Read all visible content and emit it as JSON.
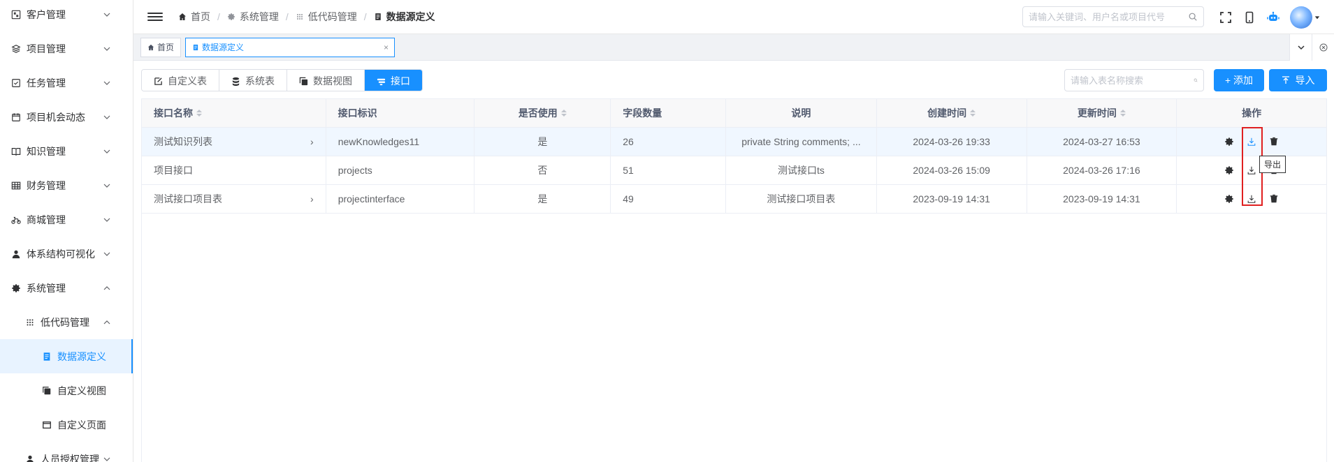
{
  "sidebar": {
    "items": [
      {
        "label": "客户管理",
        "icon": "customer-icon",
        "expanded": false
      },
      {
        "label": "项目管理",
        "icon": "layers-icon",
        "expanded": false
      },
      {
        "label": "任务管理",
        "icon": "task-icon",
        "expanded": false
      },
      {
        "label": "项目机会动态",
        "icon": "calendar-icon",
        "expanded": false
      },
      {
        "label": "知识管理",
        "icon": "book-icon",
        "expanded": false
      },
      {
        "label": "财务管理",
        "icon": "grid-icon",
        "expanded": false
      },
      {
        "label": "商城管理",
        "icon": "bike-icon",
        "expanded": false
      },
      {
        "label": "体系结构可视化",
        "icon": "user-icon",
        "expanded": false
      },
      {
        "label": "系统管理",
        "icon": "gear-icon",
        "expanded": true
      }
    ],
    "sub_group": {
      "label": "低代码管理",
      "icon": "dots-grid-icon"
    },
    "sub_items": [
      {
        "label": "数据源定义",
        "icon": "doc-icon",
        "active": true
      },
      {
        "label": "自定义视图",
        "icon": "copy-icon"
      },
      {
        "label": "自定义页面",
        "icon": "window-icon"
      }
    ],
    "cut_item": {
      "label": "人员授权管理",
      "icon": "user-icon"
    }
  },
  "header": {
    "breadcrumb": [
      {
        "label": "首页",
        "icon": "home-icon"
      },
      {
        "label": "系统管理",
        "icon": "gear-icon"
      },
      {
        "label": "低代码管理",
        "icon": "dots-grid-icon"
      },
      {
        "label": "数据源定义",
        "icon": "doc-icon"
      }
    ],
    "search_placeholder": "请输入关键词、用户名或项目代号"
  },
  "tags": {
    "items": [
      {
        "label": "首页",
        "icon": "home-icon"
      },
      {
        "label": "数据源定义",
        "icon": "doc-icon",
        "active": true
      }
    ],
    "close_glyph": "×"
  },
  "toolbar": {
    "tabs": [
      {
        "label": "自定义表",
        "icon": "edit-icon"
      },
      {
        "label": "系统表",
        "icon": "database-icon"
      },
      {
        "label": "数据视图",
        "icon": "copy-icon"
      },
      {
        "label": "接口",
        "icon": "api-icon",
        "active": true
      }
    ],
    "search_placeholder": "请输入表名称搜索",
    "add_label": "+ 添加",
    "import_label": "导入"
  },
  "table": {
    "columns": [
      "接口名称",
      "接口标识",
      "是否使用",
      "字段数量",
      "说明",
      "创建时间",
      "更新时间",
      "操作"
    ],
    "rows": [
      {
        "name": "测试知识列表",
        "key": "newKnowledges11",
        "used": "是",
        "fields": "26",
        "desc": "private String comments; ...",
        "created": "2024-03-26 19:33",
        "updated": "2024-03-27 16:53",
        "expandable": true
      },
      {
        "name": "项目接口",
        "key": "projects",
        "used": "否",
        "fields": "51",
        "desc": "测试接口ts",
        "created": "2024-03-26 15:09",
        "updated": "2024-03-26 17:16",
        "expandable": false
      },
      {
        "name": "测试接口项目表",
        "key": "projectinterface",
        "used": "是",
        "fields": "49",
        "desc": "测试接口项目表",
        "created": "2023-09-19 14:31",
        "updated": "2023-09-19 14:31",
        "expandable": true
      }
    ]
  },
  "tooltip": {
    "label": "导出"
  },
  "colors": {
    "accent": "#1890ff",
    "highlight": "#e02020"
  }
}
